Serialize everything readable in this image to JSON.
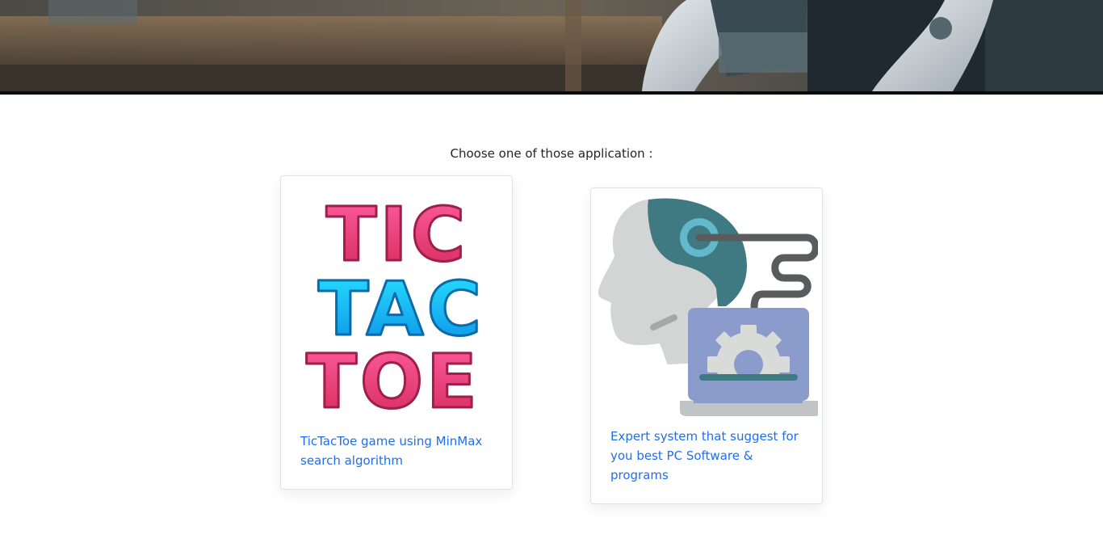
{
  "hero": {
    "image": "robot-banner"
  },
  "main": {
    "prompt": "Choose one of those application :"
  },
  "cards": [
    {
      "image_text": [
        "TIC",
        "TAC",
        "TOE"
      ],
      "link_text": "TicTacToe game using MinMax search algorithm"
    },
    {
      "icon": "ai-head-laptop-gear-icon",
      "link_text": "Expert system that suggest for you best PC Software & programs"
    }
  ],
  "colors": {
    "link": "#1f6feb",
    "pink": "#e8366f",
    "cyan": "#1ab6f5",
    "teal": "#3f7a82",
    "laptop": "#8a9bcc"
  }
}
